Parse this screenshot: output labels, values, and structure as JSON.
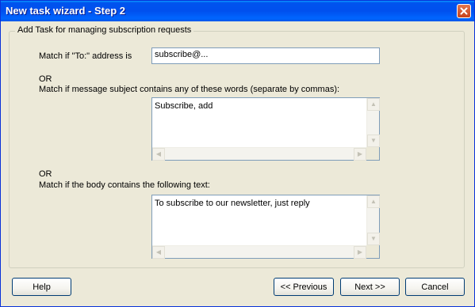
{
  "window": {
    "title": "New task wizard - Step 2"
  },
  "group": {
    "label": "Add Task for managing subscription requests"
  },
  "to_match": {
    "label": "Match if \"To:\" address is",
    "value": "subscribe@..."
  },
  "or_label": "OR",
  "subject_match": {
    "label": "Match if message subject contains any of these words (separate by commas):",
    "value": "Subscribe, add"
  },
  "body_match": {
    "label": "Match if the body contains the following text:",
    "value": "To subscribe to our newsletter, just reply"
  },
  "buttons": {
    "help": "Help",
    "previous": "<< Previous",
    "next": "Next >>",
    "cancel": "Cancel"
  }
}
